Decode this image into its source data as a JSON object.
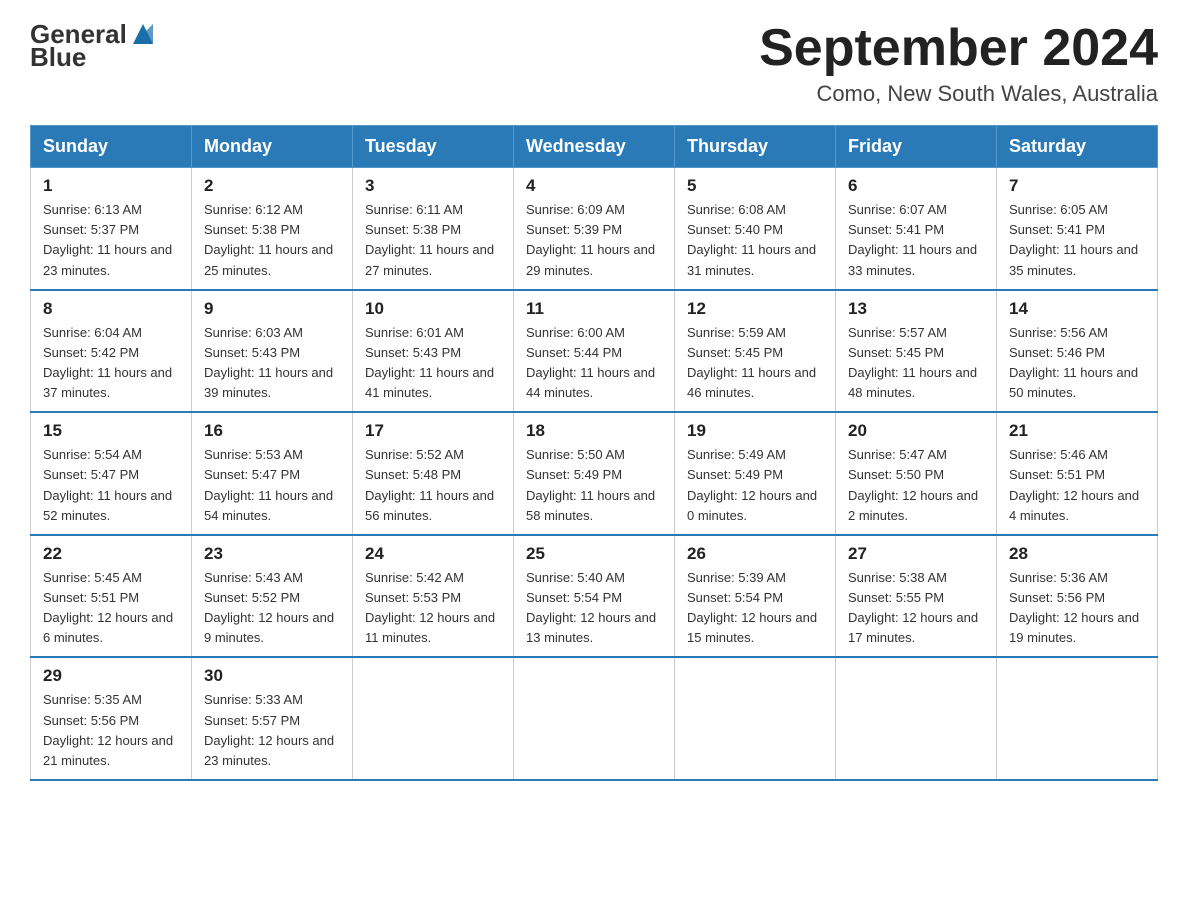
{
  "header": {
    "logo_general": "General",
    "logo_blue": "Blue",
    "title": "September 2024",
    "subtitle": "Como, New South Wales, Australia"
  },
  "days_of_week": [
    "Sunday",
    "Monday",
    "Tuesday",
    "Wednesday",
    "Thursday",
    "Friday",
    "Saturday"
  ],
  "weeks": [
    [
      {
        "day": "1",
        "sunrise": "6:13 AM",
        "sunset": "5:37 PM",
        "daylight": "11 hours and 23 minutes."
      },
      {
        "day": "2",
        "sunrise": "6:12 AM",
        "sunset": "5:38 PM",
        "daylight": "11 hours and 25 minutes."
      },
      {
        "day": "3",
        "sunrise": "6:11 AM",
        "sunset": "5:38 PM",
        "daylight": "11 hours and 27 minutes."
      },
      {
        "day": "4",
        "sunrise": "6:09 AM",
        "sunset": "5:39 PM",
        "daylight": "11 hours and 29 minutes."
      },
      {
        "day": "5",
        "sunrise": "6:08 AM",
        "sunset": "5:40 PM",
        "daylight": "11 hours and 31 minutes."
      },
      {
        "day": "6",
        "sunrise": "6:07 AM",
        "sunset": "5:41 PM",
        "daylight": "11 hours and 33 minutes."
      },
      {
        "day": "7",
        "sunrise": "6:05 AM",
        "sunset": "5:41 PM",
        "daylight": "11 hours and 35 minutes."
      }
    ],
    [
      {
        "day": "8",
        "sunrise": "6:04 AM",
        "sunset": "5:42 PM",
        "daylight": "11 hours and 37 minutes."
      },
      {
        "day": "9",
        "sunrise": "6:03 AM",
        "sunset": "5:43 PM",
        "daylight": "11 hours and 39 minutes."
      },
      {
        "day": "10",
        "sunrise": "6:01 AM",
        "sunset": "5:43 PM",
        "daylight": "11 hours and 41 minutes."
      },
      {
        "day": "11",
        "sunrise": "6:00 AM",
        "sunset": "5:44 PM",
        "daylight": "11 hours and 44 minutes."
      },
      {
        "day": "12",
        "sunrise": "5:59 AM",
        "sunset": "5:45 PM",
        "daylight": "11 hours and 46 minutes."
      },
      {
        "day": "13",
        "sunrise": "5:57 AM",
        "sunset": "5:45 PM",
        "daylight": "11 hours and 48 minutes."
      },
      {
        "day": "14",
        "sunrise": "5:56 AM",
        "sunset": "5:46 PM",
        "daylight": "11 hours and 50 minutes."
      }
    ],
    [
      {
        "day": "15",
        "sunrise": "5:54 AM",
        "sunset": "5:47 PM",
        "daylight": "11 hours and 52 minutes."
      },
      {
        "day": "16",
        "sunrise": "5:53 AM",
        "sunset": "5:47 PM",
        "daylight": "11 hours and 54 minutes."
      },
      {
        "day": "17",
        "sunrise": "5:52 AM",
        "sunset": "5:48 PM",
        "daylight": "11 hours and 56 minutes."
      },
      {
        "day": "18",
        "sunrise": "5:50 AM",
        "sunset": "5:49 PM",
        "daylight": "11 hours and 58 minutes."
      },
      {
        "day": "19",
        "sunrise": "5:49 AM",
        "sunset": "5:49 PM",
        "daylight": "12 hours and 0 minutes."
      },
      {
        "day": "20",
        "sunrise": "5:47 AM",
        "sunset": "5:50 PM",
        "daylight": "12 hours and 2 minutes."
      },
      {
        "day": "21",
        "sunrise": "5:46 AM",
        "sunset": "5:51 PM",
        "daylight": "12 hours and 4 minutes."
      }
    ],
    [
      {
        "day": "22",
        "sunrise": "5:45 AM",
        "sunset": "5:51 PM",
        "daylight": "12 hours and 6 minutes."
      },
      {
        "day": "23",
        "sunrise": "5:43 AM",
        "sunset": "5:52 PM",
        "daylight": "12 hours and 9 minutes."
      },
      {
        "day": "24",
        "sunrise": "5:42 AM",
        "sunset": "5:53 PM",
        "daylight": "12 hours and 11 minutes."
      },
      {
        "day": "25",
        "sunrise": "5:40 AM",
        "sunset": "5:54 PM",
        "daylight": "12 hours and 13 minutes."
      },
      {
        "day": "26",
        "sunrise": "5:39 AM",
        "sunset": "5:54 PM",
        "daylight": "12 hours and 15 minutes."
      },
      {
        "day": "27",
        "sunrise": "5:38 AM",
        "sunset": "5:55 PM",
        "daylight": "12 hours and 17 minutes."
      },
      {
        "day": "28",
        "sunrise": "5:36 AM",
        "sunset": "5:56 PM",
        "daylight": "12 hours and 19 minutes."
      }
    ],
    [
      {
        "day": "29",
        "sunrise": "5:35 AM",
        "sunset": "5:56 PM",
        "daylight": "12 hours and 21 minutes."
      },
      {
        "day": "30",
        "sunrise": "5:33 AM",
        "sunset": "5:57 PM",
        "daylight": "12 hours and 23 minutes."
      },
      null,
      null,
      null,
      null,
      null
    ]
  ],
  "labels": {
    "sunrise_prefix": "Sunrise: ",
    "sunset_prefix": "Sunset: ",
    "daylight_prefix": "Daylight: "
  }
}
